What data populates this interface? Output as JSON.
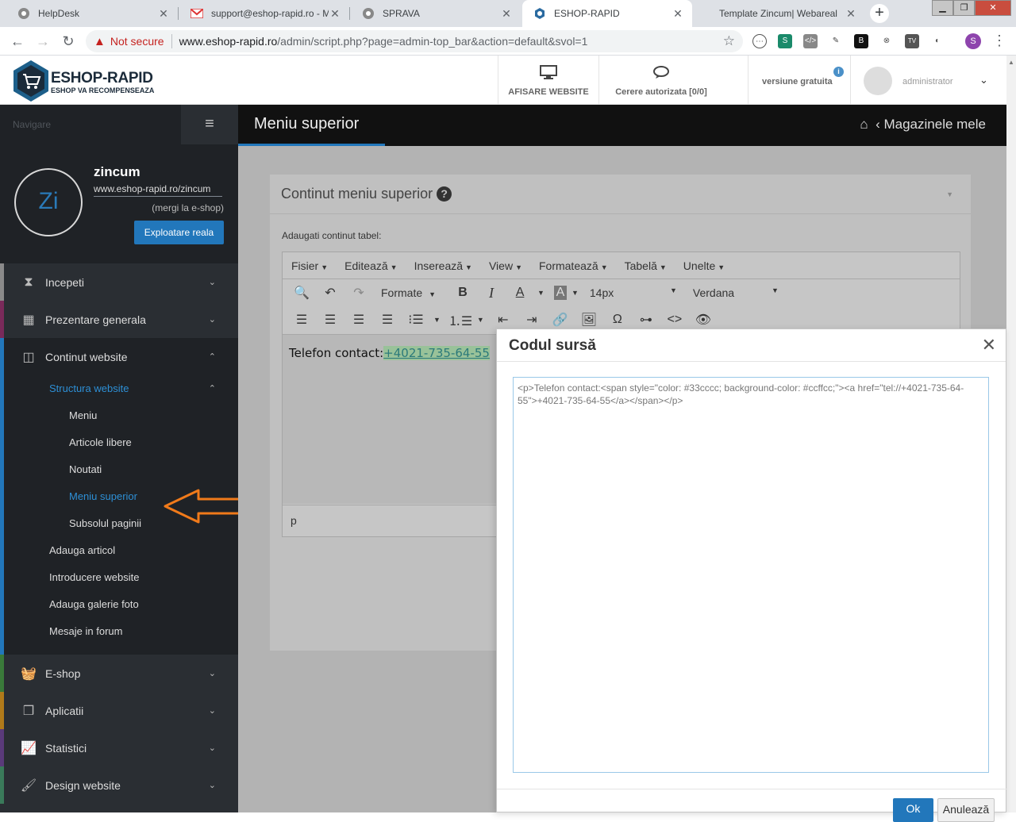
{
  "browser": {
    "tabs": [
      {
        "label": "HelpDesk",
        "icon": "chrome-icon",
        "active": false
      },
      {
        "label": "support@eshop-rapid.ro - M",
        "icon": "gmail-icon",
        "active": false
      },
      {
        "label": "SPRAVA",
        "icon": "chrome-icon",
        "active": false
      },
      {
        "label": "ESHOP-RAPID",
        "icon": "eshop-icon",
        "active": true
      },
      {
        "label": "Template Zincum| Webareal",
        "icon": "none",
        "active": false
      }
    ],
    "not_secure": "Not secure",
    "url_host": "www.eshop-rapid.ro",
    "url_path": "/admin/script.php?page=admin-top_bar&action=default&svol=1",
    "profile_initial": "S"
  },
  "header": {
    "brand": "ESHOP-RAPID",
    "slogan": "ESHOP VA RECOMPENSEAZA",
    "items": [
      {
        "label": "AFISARE WEBSITE",
        "icon": "monitor-icon"
      },
      {
        "label": "Cerere autorizata [0/0]",
        "icon": "chat-icon"
      }
    ],
    "version_label": "versiune gratuita",
    "username": "administrator"
  },
  "sidebar": {
    "nav_label": "Navigare",
    "shop_initials": "Zi",
    "shop_name": "zincum",
    "shop_url": "www.eshop-rapid.ro/zincum",
    "goto_link": "(mergi la e-shop)",
    "exploit_button": "Exploatare reala",
    "items": [
      {
        "label": "Incepeti",
        "icon": "hourglass-icon",
        "color": "#8a8a8a"
      },
      {
        "label": "Prezentare generala",
        "icon": "grid-icon",
        "color": "#7a2a5a"
      },
      {
        "label": "Continut website",
        "icon": "columns-icon",
        "color": "#2277bb"
      }
    ],
    "submenu": {
      "section": "Structura website",
      "children": [
        "Meniu",
        "Articole libere",
        "Noutati",
        "Meniu superior",
        "Subsolul paginii"
      ],
      "others": [
        "Adauga articol",
        "Introducere website",
        "Adauga galerie foto",
        "Mesaje in forum"
      ]
    },
    "bottom_items": [
      {
        "label": "E-shop",
        "icon": "basket-icon",
        "color": "#3a7a3a"
      },
      {
        "label": "Aplicatii",
        "icon": "cubes-icon",
        "color": "#b07a1a"
      },
      {
        "label": "Statistici",
        "icon": "chart-icon",
        "color": "#5a3a7a"
      },
      {
        "label": "Design website",
        "icon": "brush-icon",
        "color": "#3a7a5a"
      }
    ]
  },
  "main": {
    "title": "Meniu superior",
    "breadcrumb": "Magazinele mele",
    "panel_title": "Continut meniu superior",
    "table_label": "Adaugati continut tabel:",
    "editor_menus": [
      "Fisier",
      "Editează",
      "Inserează",
      "View",
      "Formatează",
      "Tabelă",
      "Unelte"
    ],
    "format_label": "Formate",
    "font_size": "14px",
    "font_family": "Verdana",
    "content_text": "Telefon contact:",
    "content_phone": "+4021-735-64-55",
    "status_path": "p"
  },
  "modal": {
    "title": "Codul sursă",
    "source": "<p>Telefon contact:<span style=\"color: #33cccc; background-color: #ccffcc;\"><a href=\"tel://+4021-735-64-55\">+4021-735-64-55</a></span></p>",
    "ok_label": "Ok",
    "cancel_label": "Anulează"
  }
}
